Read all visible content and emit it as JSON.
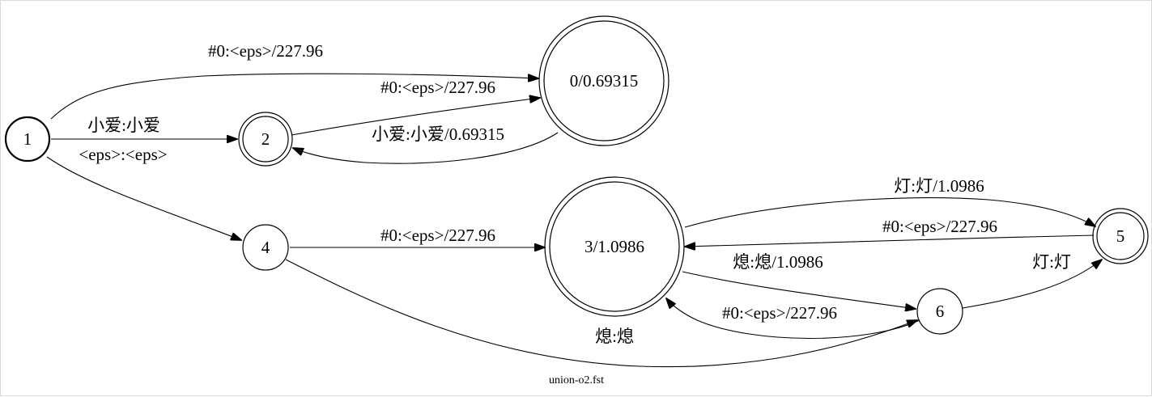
{
  "graph": {
    "caption": "union-o2.fst",
    "nodes": [
      {
        "id": "1",
        "label": "1",
        "start": true,
        "final": false
      },
      {
        "id": "2",
        "label": "2",
        "start": false,
        "final": true
      },
      {
        "id": "0",
        "label": "0/0.69315",
        "start": false,
        "final": true
      },
      {
        "id": "4",
        "label": "4",
        "start": false,
        "final": false
      },
      {
        "id": "3",
        "label": "3/1.0986",
        "start": false,
        "final": true
      },
      {
        "id": "5",
        "label": "5",
        "start": false,
        "final": true
      },
      {
        "id": "6",
        "label": "6",
        "start": false,
        "final": false
      }
    ],
    "edges": [
      {
        "from": "1",
        "to": "0",
        "label": "#0:<eps>/227.96"
      },
      {
        "from": "1",
        "to": "2",
        "label": "小爱:小爱"
      },
      {
        "from": "1",
        "to": "4",
        "label": "<eps>:<eps>"
      },
      {
        "from": "2",
        "to": "0",
        "label": "#0:<eps>/227.96"
      },
      {
        "from": "0",
        "to": "2",
        "label": "小爱:小爱/0.69315"
      },
      {
        "from": "4",
        "to": "3",
        "label": "#0:<eps>/227.96"
      },
      {
        "from": "4",
        "to": "6",
        "label": "熄:熄"
      },
      {
        "from": "3",
        "to": "5",
        "label": "灯:灯/1.0986"
      },
      {
        "from": "5",
        "to": "3",
        "label": "#0:<eps>/227.96"
      },
      {
        "from": "3",
        "to": "6",
        "label": "熄:熄/1.0986"
      },
      {
        "from": "6",
        "to": "3",
        "label": "#0:<eps>/227.96"
      },
      {
        "from": "6",
        "to": "5",
        "label": "灯:灯"
      }
    ]
  }
}
